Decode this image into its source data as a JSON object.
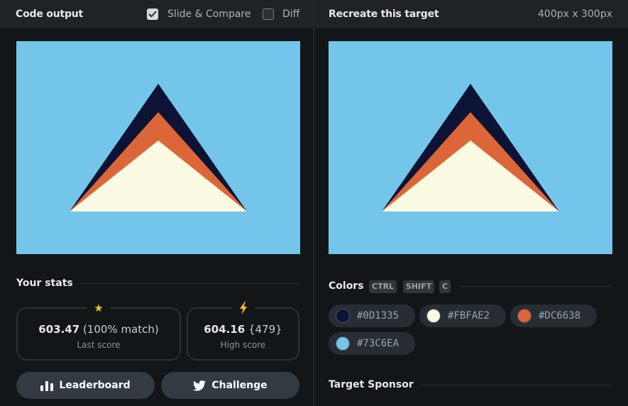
{
  "left_panel": {
    "title": "Code output",
    "slide_compare": {
      "label": "Slide & Compare",
      "checked": true
    },
    "diff": {
      "label": "Diff",
      "checked": false
    }
  },
  "right_panel": {
    "title": "Recreate this target",
    "dimensions": "400px x 300px"
  },
  "canvas": {
    "background": "#73C6EA",
    "colors": {
      "dark": "#0D1335",
      "orange": "#DC6638",
      "cream": "#FBFAE2"
    }
  },
  "stats": {
    "heading": "Your stats",
    "last_score": {
      "icon": "star-icon",
      "value": "603.47",
      "detail": "(100% match)",
      "caption": "Last score"
    },
    "high_score": {
      "icon": "lightning-icon",
      "value": "604.16",
      "detail": "{479}",
      "caption": "High score"
    }
  },
  "buttons": {
    "leaderboard": {
      "label": "Leaderboard",
      "icon": "bar-chart-icon"
    },
    "challenge": {
      "label": "Challenge",
      "icon": "twitter-icon"
    }
  },
  "colors_section": {
    "heading": "Colors",
    "shortcut_keys": [
      "CTRL",
      "SHIFT",
      "C"
    ],
    "swatches": [
      {
        "hex": "#0D1335",
        "label": "#0D1335"
      },
      {
        "hex": "#FBFAE2",
        "label": "#FBFAE2"
      },
      {
        "hex": "#DC6638",
        "label": "#DC6638"
      },
      {
        "hex": "#73C6EA",
        "label": "#73C6EA"
      }
    ]
  },
  "sponsor": {
    "heading": "Target Sponsor"
  }
}
